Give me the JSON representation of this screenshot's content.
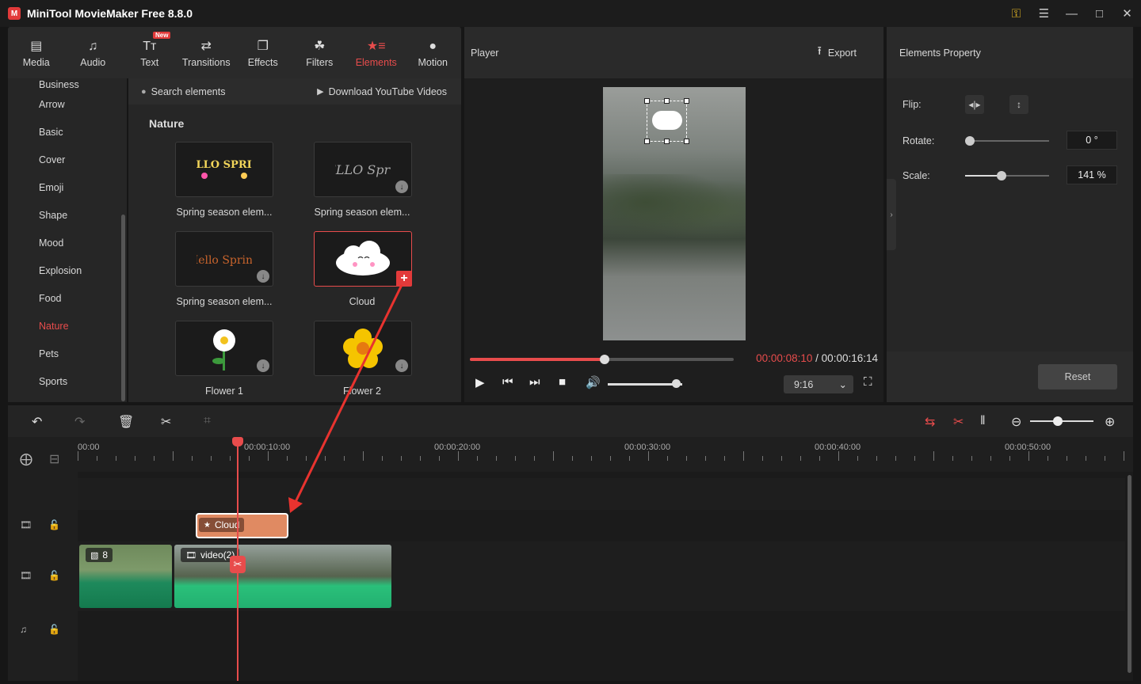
{
  "app": {
    "title": "MiniTool MovieMaker Free 8.8.0",
    "logo_text": "M",
    "accent_color": "#e84c4c"
  },
  "toolbar": {
    "tabs": [
      {
        "label": "Media",
        "icon": "media-folder-icon"
      },
      {
        "label": "Audio",
        "icon": "music-note-icon"
      },
      {
        "label": "Text",
        "icon": "text-icon",
        "badge": "New"
      },
      {
        "label": "Transitions",
        "icon": "transitions-icon"
      },
      {
        "label": "Effects",
        "icon": "effects-icon"
      },
      {
        "label": "Filters",
        "icon": "filters-icon"
      },
      {
        "label": "Elements",
        "icon": "elements-icon",
        "active": true
      },
      {
        "label": "Motion",
        "icon": "motion-icon"
      }
    ]
  },
  "categories": [
    "Business",
    "Arrow",
    "Basic",
    "Cover",
    "Emoji",
    "Shape",
    "Mood",
    "Explosion",
    "Food",
    "Nature",
    "Pets",
    "Sports"
  ],
  "active_category": "Nature",
  "elements": {
    "search_label": "Search elements",
    "download_label": "Download YouTube Videos",
    "section_title": "Nature",
    "items": [
      {
        "label": "Spring season elem...",
        "art": "HELLO SPRING"
      },
      {
        "label": "Spring season elem...",
        "art": "HELLO Spring"
      },
      {
        "label": "Spring season elem...",
        "art": "Hello Spring"
      },
      {
        "label": "Cloud",
        "art": "cloud"
      },
      {
        "label": "Flower 1",
        "art": "white flower"
      },
      {
        "label": "Flower 2",
        "art": "yellow flower"
      }
    ]
  },
  "player": {
    "title": "Player",
    "export_label": "Export",
    "current_time": "00:00:08:10",
    "separator": " / ",
    "total_time": "00:00:16:14",
    "progress": 0.51,
    "volume": 0.92,
    "aspect_ratio": "9:16"
  },
  "properties": {
    "title": "Elements Property",
    "flip_label": "Flip:",
    "rotate_label": "Rotate:",
    "rotate_value": "0 °",
    "rotate_fraction": 0.0,
    "scale_label": "Scale:",
    "scale_value": "141 %",
    "scale_fraction": 0.38,
    "reset_label": "Reset"
  },
  "timeline": {
    "ruler_labels": [
      "00:00",
      "00:00:10:00",
      "00:00:20:00",
      "00:00:30:00",
      "00:00:40:00",
      "00:00:50:00"
    ],
    "clips": {
      "element_label": "Cloud",
      "image_label": "8",
      "video_label": "video(2)"
    }
  }
}
